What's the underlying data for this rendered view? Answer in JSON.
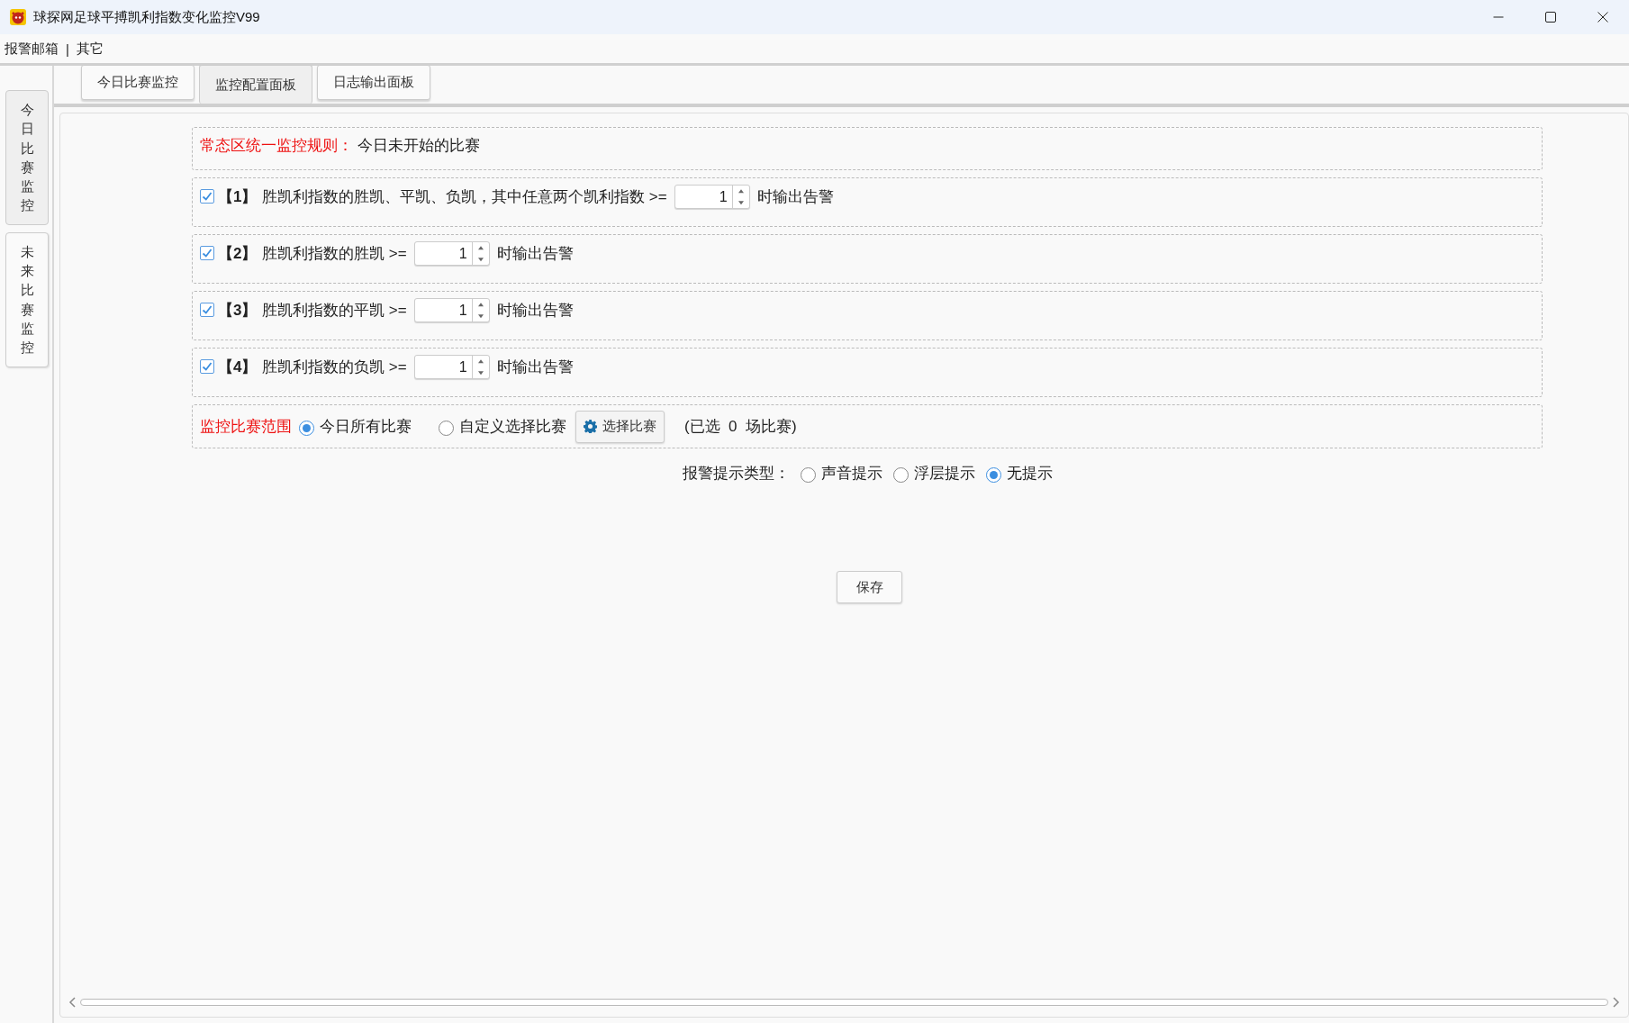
{
  "window": {
    "title": "球探网足球平搏凯利指数变化监控V99"
  },
  "menu": [
    {
      "label": "报警邮箱"
    },
    {
      "label": "其它"
    }
  ],
  "menu_separator": "|",
  "side_tabs": [
    {
      "label": "今日比赛监控",
      "selected": true
    },
    {
      "label": "未来比赛监控",
      "selected": false
    }
  ],
  "tabs": [
    {
      "label": "今日比赛监控",
      "selected": false
    },
    {
      "label": "监控配置面板",
      "selected": true
    },
    {
      "label": "日志输出面板",
      "selected": false
    }
  ],
  "rule_header": {
    "label": "常态区统一监控规则：",
    "value": "今日未开始的比赛"
  },
  "rules": [
    {
      "checked": true,
      "number": "【1】",
      "text": "胜凯利指数的胜凯、平凯、负凯，其中任意两个凯利指数 >=",
      "value": "1",
      "suffix": "时输出告警"
    },
    {
      "checked": true,
      "number": "【2】",
      "text": "胜凯利指数的胜凯 >=",
      "value": "1",
      "suffix": "时输出告警"
    },
    {
      "checked": true,
      "number": "【3】",
      "text": "胜凯利指数的平凯 >=",
      "value": "1",
      "suffix": "时输出告警"
    },
    {
      "checked": true,
      "number": "【4】",
      "text": "胜凯利指数的负凯 >=",
      "value": "1",
      "suffix": "时输出告警"
    }
  ],
  "scope": {
    "label": "监控比赛范围",
    "options": [
      {
        "label": "今日所有比赛",
        "selected": true
      },
      {
        "label": "自定义选择比赛",
        "selected": false
      }
    ],
    "button": "选择比赛",
    "note": "(已选  0  场比赛)"
  },
  "alarm_type": {
    "label": "报警提示类型：",
    "options": [
      {
        "label": "声音提示",
        "selected": false
      },
      {
        "label": "浮层提示",
        "selected": false
      },
      {
        "label": "无提示",
        "selected": true
      }
    ]
  },
  "save_button": "保存"
}
